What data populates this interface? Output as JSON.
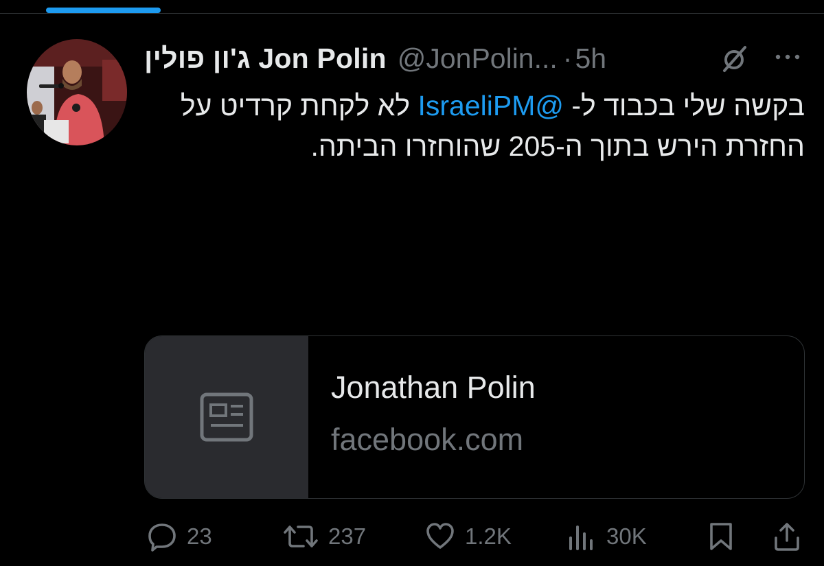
{
  "tweet": {
    "author_name": "ג'ון פולין Jon Polin",
    "handle": "@JonPolin...",
    "separator": "·",
    "time": "5h",
    "text_before": "בקשה שלי בכבוד ל- ",
    "mention": "@IsraeliPM",
    "text_after": " לא לקחת קרדיט על החזרת הירש בתוך ה-205 שהוחזרו הביתה."
  },
  "card": {
    "title": "Jonathan Polin",
    "domain": "facebook.com",
    "thumb_icon": "article-icon"
  },
  "actions": {
    "replies": "23",
    "reposts": "237",
    "likes": "1.2K",
    "views": "30K"
  },
  "icons": [
    "mute-icon",
    "more-icon",
    "reply-icon",
    "repost-icon",
    "like-icon",
    "views-icon",
    "bookmark-icon",
    "share-icon"
  ],
  "colors": {
    "background": "#000000",
    "text": "#e7e9ea",
    "muted": "#71767b",
    "accent": "#1d9bf0"
  }
}
